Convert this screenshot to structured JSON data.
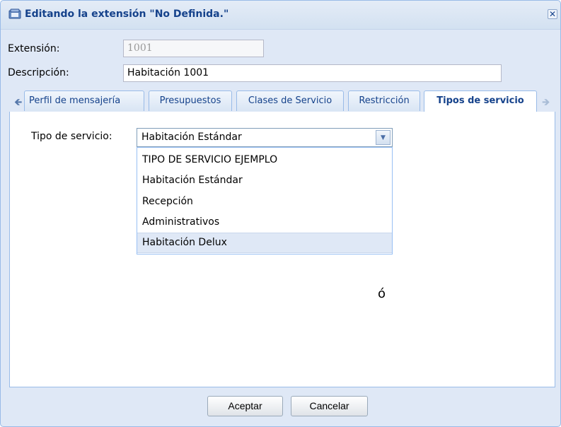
{
  "window": {
    "title": "Editando la extensión \"No Definida.\"",
    "close_symbol": "✕"
  },
  "form": {
    "extension_label": "Extensión:",
    "extension_value": "1001",
    "description_label": "Descripción:",
    "description_value": "Habitación 1001"
  },
  "tabs": {
    "scroll_left_icon": "arrow-left-icon",
    "scroll_right_icon": "arrow-right-icon",
    "items": [
      {
        "label": "Perfil de mensajería"
      },
      {
        "label": "Presupuestos"
      },
      {
        "label": "Clases de Servicio"
      },
      {
        "label": "Restricción"
      },
      {
        "label": "Tipos de servicio",
        "active": true
      }
    ]
  },
  "service_type": {
    "label": "Tipo de servicio:",
    "selected": "Habitación Estándar",
    "options": [
      "TIPO DE SERVICIO EJEMPLO",
      "Habitación Estándar",
      "Recepción",
      "Administrativos",
      "Habitación Delux"
    ],
    "highlighted_index": 4
  },
  "stray_char": "ó",
  "footer": {
    "accept_label": "Aceptar",
    "cancel_label": "Cancelar"
  },
  "colors": {
    "title_text": "#15428b",
    "window_bg": "#dfe8f6",
    "border": "#99bbe8"
  }
}
